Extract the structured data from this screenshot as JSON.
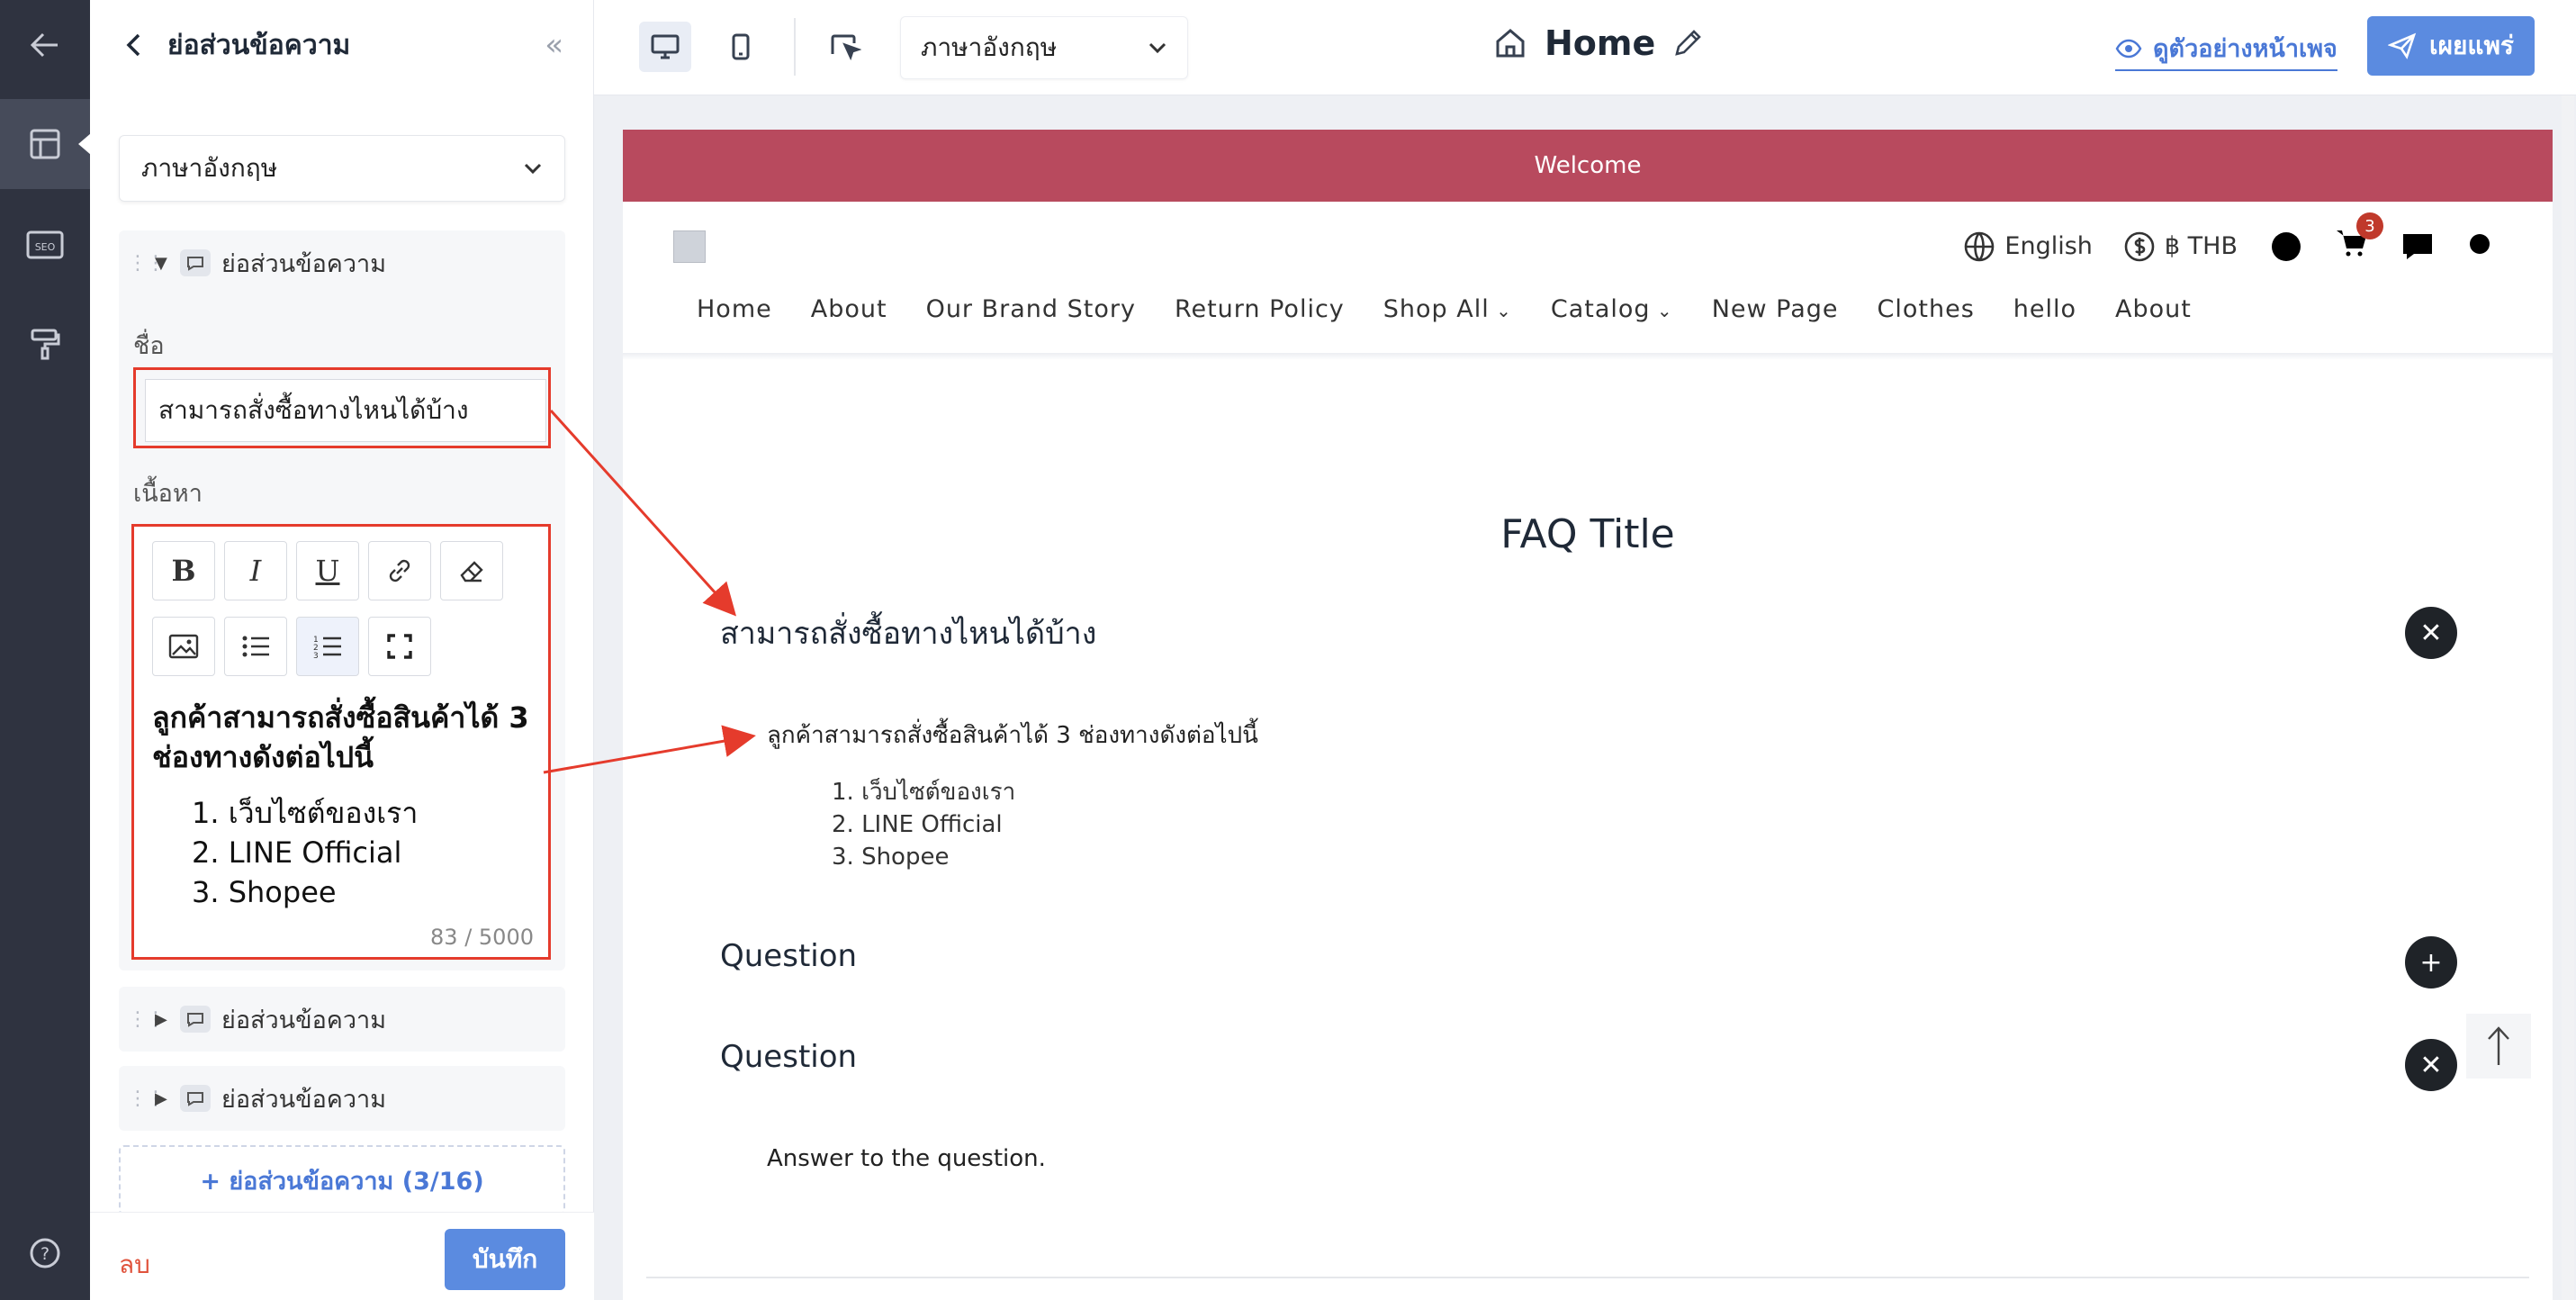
{
  "rail": {
    "items": [
      {
        "icon": "back-arrow-icon"
      },
      {
        "icon": "layout-icon",
        "active": true
      },
      {
        "icon": "seo-icon",
        "label": "SEO"
      },
      {
        "icon": "paint-roller-icon"
      },
      {
        "icon": "help-icon",
        "label": "?"
      }
    ]
  },
  "sidebar": {
    "title": "ย่อส่วนข้อความ",
    "language": "ภาษาอังกฤษ",
    "section_label": "ย่อส่วนข้อความ",
    "name_label": "ชื่อ",
    "name_value": "สามารถสั่งซื้อทางไหนได้บ้าง",
    "content_label": "เนื้อหา",
    "toolbar": [
      "B",
      "I",
      "U",
      "link",
      "eraser",
      "image",
      "bullet-list",
      "numbered-list",
      "fullscreen"
    ],
    "editor_lead": "ลูกค้าสามารถสั่งซื้อสินค้าได้ 3 ช่องทางดังต่อไปนี้",
    "editor_items": [
      "1. เว็บไซต์ของเรา",
      "2. LINE Official",
      "3. Shopee"
    ],
    "counter": "83 / 5000",
    "collapsed_sections": [
      "ย่อส่วนข้อความ",
      "ย่อส่วนข้อความ"
    ],
    "add_section": "+ ย่อส่วนข้อความ (3/16)",
    "delete": "ลบ",
    "save": "บันทึก"
  },
  "topbar": {
    "language": "ภาษาอังกฤษ",
    "page_name": "Home",
    "preview": "ดูตัวอย่างหน้าเพจ",
    "publish": "เผยแพร่"
  },
  "site": {
    "welcome": "Welcome",
    "language": "English",
    "currency": "฿ THB",
    "cart_count": "3",
    "nav": [
      {
        "label": "Home",
        "dropdown": false
      },
      {
        "label": "About",
        "dropdown": false
      },
      {
        "label": "Our Brand Story",
        "dropdown": false
      },
      {
        "label": "Return Policy",
        "dropdown": false
      },
      {
        "label": "Shop All",
        "dropdown": true
      },
      {
        "label": "Catalog",
        "dropdown": true
      },
      {
        "label": "New Page",
        "dropdown": false
      },
      {
        "label": "Clothes",
        "dropdown": false
      },
      {
        "label": "hello",
        "dropdown": false
      },
      {
        "label": "About",
        "dropdown": false
      }
    ],
    "faq_title": "FAQ Title",
    "faq": [
      {
        "question": "สามารถสั่งซื้อทางไหนได้บ้าง",
        "answer": "ลูกค้าสามารถสั่งซื้อสินค้าได้ 3 ช่องทางดังต่อไปนี้",
        "items": [
          "1. เว็บไซต์ของเรา",
          "2. LINE Official",
          "3. Shopee"
        ],
        "expanded": true
      },
      {
        "question": "Question",
        "expanded": false
      },
      {
        "question": "Question",
        "answer": "Answer to the question.",
        "expanded": true
      }
    ]
  },
  "colors": {
    "rail": "#2f3340",
    "accent": "#5b8be0",
    "welcome_bar": "#b84a5e",
    "annotation": "#e53b2c"
  }
}
